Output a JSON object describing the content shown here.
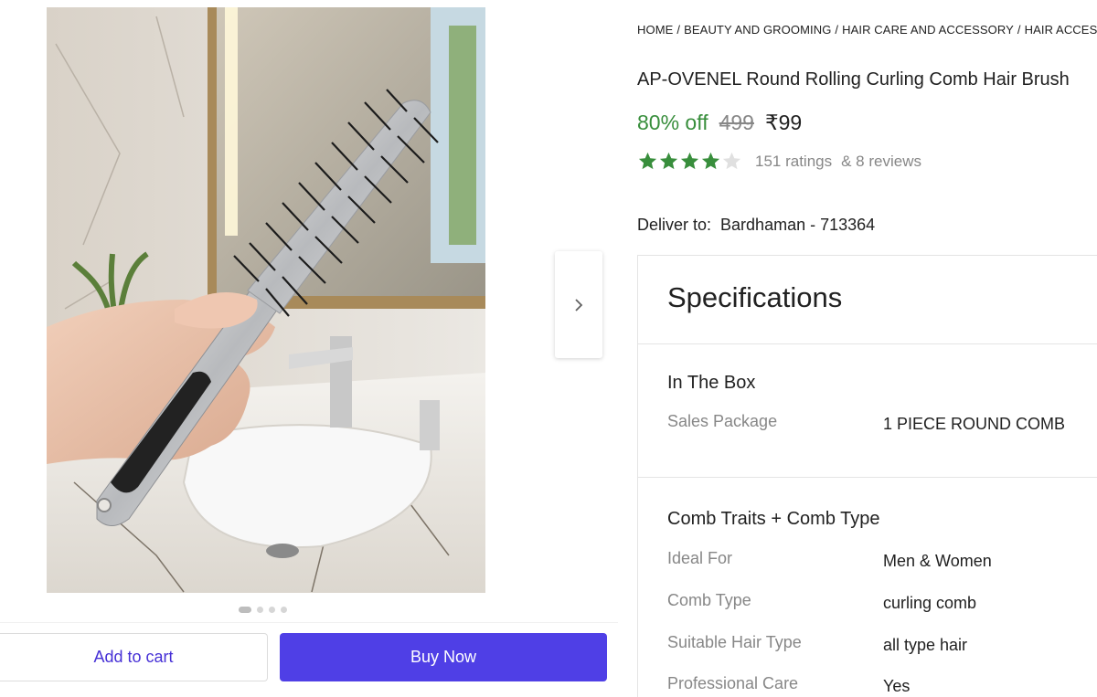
{
  "breadcrumb": [
    "HOME",
    "BEAUTY AND GROOMING",
    "HAIR CARE AND ACCESSORY",
    "HAIR ACCESSORY"
  ],
  "product": {
    "title": "AP-OVENEL Round Rolling Curling Comb Hair Brush",
    "discount": "80% off",
    "mrp": "499",
    "price": "₹99",
    "rating_value": 4,
    "rating_max": 5,
    "ratings_text": "151 ratings",
    "reviews_text": "& 8 reviews"
  },
  "delivery": {
    "label": "Deliver to:",
    "location": "Bardhaman - 713364"
  },
  "gallery": {
    "image_count": 4,
    "active_index": 0,
    "next_icon": "chevron-right-icon"
  },
  "actions": {
    "add_to_cart": "Add to cart",
    "buy_now": "Buy Now"
  },
  "specifications": {
    "title": "Specifications",
    "sections": [
      {
        "title": "In The Box",
        "rows": [
          {
            "key": "Sales Package",
            "value": "1 PIECE ROUND COMB"
          }
        ]
      },
      {
        "title": "Comb Traits + Comb Type",
        "rows": [
          {
            "key": "Ideal For",
            "value": "Men & Women"
          },
          {
            "key": "Comb Type",
            "value": "curling comb"
          },
          {
            "key": "Suitable Hair Type",
            "value": "all type hair"
          },
          {
            "key": "Professional Care",
            "value": "Yes"
          }
        ]
      }
    ]
  },
  "colors": {
    "discount_green": "#388e3c",
    "star_green": "#388e3c",
    "buy_button": "#4f3fe6",
    "cart_text": "#4630d6"
  }
}
